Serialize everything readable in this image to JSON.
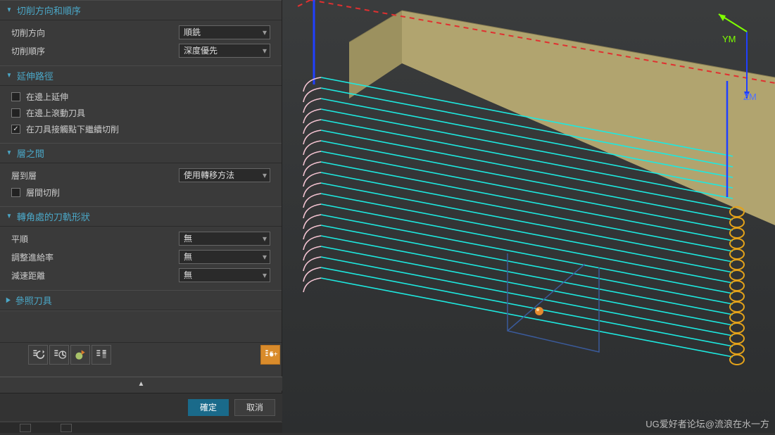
{
  "sections": {
    "cut_direction": {
      "title": "切削方向和順序",
      "direction_label": "切削方向",
      "direction_value": "順銑",
      "order_label": "切削順序",
      "order_value": "深度優先"
    },
    "extend_path": {
      "title": "延伸路徑",
      "extend_on_edge": "在邊上延伸",
      "roll_on_edge": "在邊上滾動刀具",
      "continue_below_contact": "在刀具接觸點下繼續切削"
    },
    "between_layers": {
      "title": "層之間",
      "layer_to_layer_label": "層到層",
      "layer_to_layer_value": "使用轉移方法",
      "interlayer_cut": "層間切削"
    },
    "corner_shape": {
      "title": "轉角處的刀軌形狀",
      "smooth_label": "平順",
      "smooth_value": "無",
      "adjust_feed_label": "調整進給率",
      "adjust_feed_value": "無",
      "decel_dist_label": "減速距離",
      "decel_dist_value": "無"
    },
    "ref_tool": {
      "title": "參照刀具"
    }
  },
  "checkboxes": {
    "extend_on_edge": false,
    "roll_on_edge": false,
    "continue_below_contact": true,
    "interlayer_cut": false
  },
  "buttons": {
    "ok": "確定",
    "cancel": "取消"
  },
  "axes": {
    "ym": "YM",
    "zm": "ZM"
  },
  "watermark": "UG爱好者论坛@流浪在水一方",
  "colors": {
    "accent": "#4ba8c8",
    "primary_btn": "#1a6a8a",
    "toolpath": "#1de9e0",
    "lead": "#f4c4d2",
    "helix": "#e3a21a",
    "dashed": "#e03030",
    "axis_y": "#7fff00",
    "axis_z": "#2040ff"
  }
}
